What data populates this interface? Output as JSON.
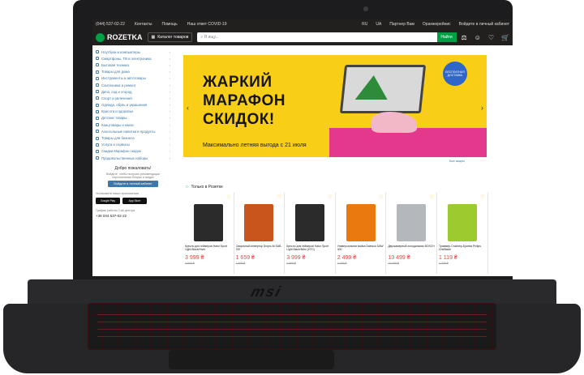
{
  "topbar": {
    "phone": "(044) 537-02-22",
    "links": [
      "Контакты",
      "Помощь",
      "Наш ответ COVID-19"
    ],
    "lang": [
      "RU",
      "UA"
    ],
    "right_links": [
      "Партнер Вам",
      "Оранжерейнис",
      "Войдите в личный кабинет"
    ]
  },
  "header": {
    "logo": "ROZETKA",
    "catalog_label": "Каталог товаров",
    "search_placeholder": "Я ищу...",
    "search_button": "Найти"
  },
  "sidebar": {
    "items": [
      "Ноутбуки и компьютеры",
      "Смартфоны, ТВ и электроника",
      "Бытовая техника",
      "Товары для дома",
      "Инструменты и автотовары",
      "Сантехника и ремонт",
      "Дача, сад и огород",
      "Спорт и увлечения",
      "Одежда, обувь и украшения",
      "Красота и здоровье",
      "Детские товары",
      "Канцтовары и книги",
      "Алкогольные напитки и продукты",
      "Товары для бизнеса",
      "Услуги и сервисы",
      "Скидки Марафон скидок",
      "Продовольственные наборы"
    ],
    "welcome_title": "Добро пожаловать!",
    "welcome_sub": "Войдите, чтобы получать рекомендации персональные бонусы и скидки",
    "login_button": "Войдите в личный кабинет",
    "apps_label": "Установите наши приложения",
    "google_play": "Google Play",
    "app_store": "App Store",
    "contacts_label": "График работы Call-центра",
    "phone": "+38 044 537-02-22"
  },
  "banner": {
    "title": "ЖАРКИЙ МАРАФОН СКИДОК!",
    "subtitle": "Максимально летняя выгода с 21 июля",
    "stamp": "БЕСПЛАТНАЯ ДОСТАВКА",
    "all_actions": "Все акции"
  },
  "section": {
    "title": "Только в Розетке"
  },
  "products": [
    {
      "name": "Кресло для геймеров Hator Sport Light Black/Hiver",
      "price": "3 999 ₴",
      "old": "4 999 ₴",
      "color": "#2b2b2b"
    },
    {
      "name": "Сварочный инвертор Dnipro-M SAB-220",
      "price": "1 659 ₴",
      "old": "1 999 ₴",
      "color": "#c9551c"
    },
    {
      "name": "Кресло для геймеров Hator Sport Light Black/Nitro (HTC)",
      "price": "3 999 ₴",
      "old": "4 999 ₴",
      "color": "#2b2b2b"
    },
    {
      "name": "Универсальная мойка Daewoo DAW 400",
      "price": "2 499 ₴",
      "old": "3 499 ₴",
      "color": "#ea7a10"
    },
    {
      "name": "Двухкамерный холодильник BOSCH",
      "price": "13 499 ₴",
      "old": "15 499 ₴",
      "color": "#b4b8bc"
    },
    {
      "name": "Триммер-Стайлер-Бритва Philips OneBlade",
      "price": "1 119 ₴",
      "old": "1 399 ₴",
      "color": "#9ccb2f"
    }
  ]
}
